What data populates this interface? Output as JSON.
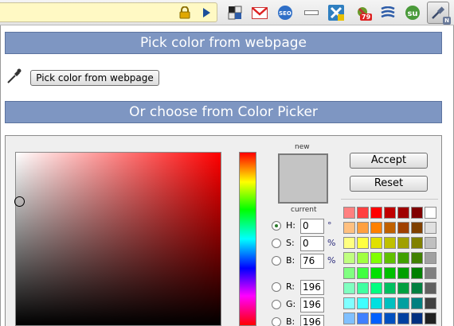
{
  "toolbar": {
    "icons": [
      "lock-icon",
      "play-icon",
      "grid-app-icon",
      "gmail-icon",
      "seo-icon",
      "minus-icon",
      "x-extension-icon",
      "notification-icon",
      "stack-icon",
      "stumbleupon-icon",
      "eyedropper-extension-icon"
    ],
    "seo_label": "SEO",
    "notification_count": "79",
    "stumble_label": "su",
    "corner_badge": "N"
  },
  "page_header": {
    "title": "Pick color from webpage"
  },
  "pick_button": {
    "label": "Pick color from webpage"
  },
  "picker_header": {
    "title": "Or choose from Color Picker"
  },
  "picker": {
    "new_label": "new",
    "current_label": "current",
    "new_color": "#c4c4c4",
    "hue_fields": [
      {
        "label": "H:",
        "value": "0",
        "unit": "°",
        "selected": true
      },
      {
        "label": "S:",
        "value": "0",
        "unit": "%",
        "selected": false
      },
      {
        "label": "B:",
        "value": "76",
        "unit": "%",
        "selected": false
      }
    ],
    "rgb_fields": [
      {
        "label": "R:",
        "value": "196"
      },
      {
        "label": "G:",
        "value": "196"
      },
      {
        "label": "B:",
        "value": "196"
      }
    ],
    "accept_label": "Accept",
    "reset_label": "Reset",
    "palette": [
      [
        "#ff8080",
        "#ff4040",
        "#ff0000",
        "#c00000",
        "#a00000",
        "#800000",
        "#ffffff"
      ],
      [
        "#ffc080",
        "#ffa040",
        "#ff8000",
        "#c06000",
        "#a04000",
        "#804000",
        "#e0e0e0"
      ],
      [
        "#ffff80",
        "#ffff40",
        "#e0e000",
        "#c0c000",
        "#a0a000",
        "#808000",
        "#c0c0c0"
      ],
      [
        "#c0ff80",
        "#a0ff40",
        "#80ff00",
        "#60c000",
        "#40a000",
        "#408000",
        "#a0a0a0"
      ],
      [
        "#80ff80",
        "#40ff40",
        "#00e000",
        "#00c000",
        "#00a000",
        "#008000",
        "#808080"
      ],
      [
        "#80ffc0",
        "#40ffa0",
        "#00ff80",
        "#00c060",
        "#00a040",
        "#008040",
        "#606060"
      ],
      [
        "#80ffff",
        "#40ffff",
        "#00e0e0",
        "#00c0c0",
        "#00a0a0",
        "#008080",
        "#404040"
      ],
      [
        "#80c0ff",
        "#4080ff",
        "#0060ff",
        "#0050c0",
        "#0040a0",
        "#003080",
        "#202020"
      ]
    ]
  }
}
